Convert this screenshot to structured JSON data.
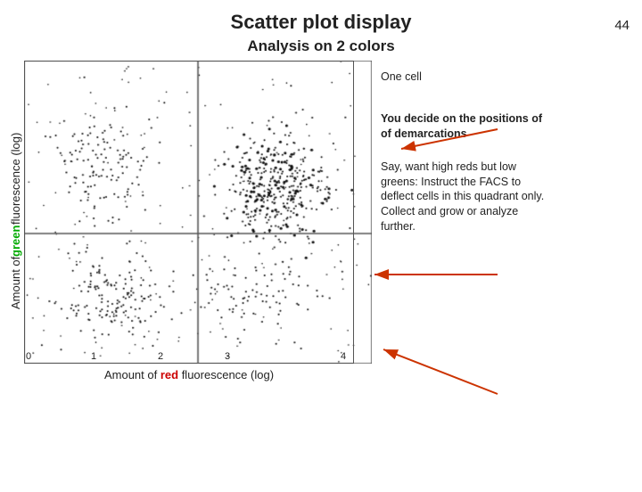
{
  "page": {
    "number": "44",
    "title": "Scatter plot display",
    "subtitle": "Analysis on 2 colors"
  },
  "chart": {
    "y_label_prefix": "Amount of ",
    "y_label_green": "green",
    "y_label_suffix": " fluorescence (log)",
    "x_label_prefix": "Amount of ",
    "x_label_red": "red",
    "x_label_suffix": " fluorescence (log)",
    "x_ticks": [
      "0",
      "1",
      "2",
      "3",
      "4"
    ],
    "quadrant_h_pct": 57,
    "quadrant_v_pct": 50
  },
  "annotations": {
    "one_cell": "One cell",
    "you_decide": "You decide on the positions of of demarcations",
    "say_want": "Say, want high reds but low greens: Instruct the FACS to deflect cells in this quadrant only. Collect and grow or analyze further."
  }
}
